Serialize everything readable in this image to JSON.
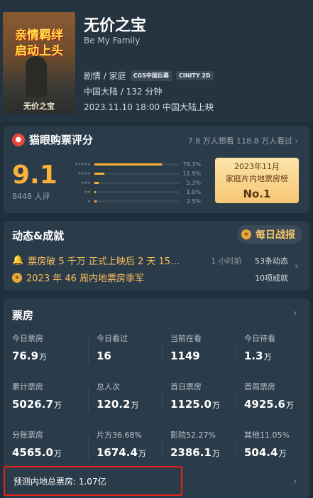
{
  "movie": {
    "poster_slogan_line1": "亲情羁绊",
    "poster_slogan_line2": "启动上头",
    "poster_title": "无价之宝",
    "title": "无价之宝",
    "english_title": "Be My Family",
    "genres": "剧情 / 家庭",
    "badges": [
      "CGS中国巨幕",
      "CINITY 2D"
    ],
    "region_duration": "中国大陆 / 132 分钟",
    "release": "2023.11.10 18:00 中国大陆上映"
  },
  "rating": {
    "header": "猫眼购票评分",
    "icon": "cat-icon",
    "counts": "7.8 万人想看  118.8 万人看过",
    "score": "9.1",
    "score_count": "8448 人评",
    "distribution": [
      {
        "stars": "★★★★★",
        "pct": "79.3%",
        "fraction": 0.793
      },
      {
        "stars": "★★★★",
        "pct": "11.9%",
        "fraction": 0.119
      },
      {
        "stars": "★★★",
        "pct": "5.3%",
        "fraction": 0.053
      },
      {
        "stars": "★★",
        "pct": "1.0%",
        "fraction": 0.01
      },
      {
        "stars": "★",
        "pct": "2.5%",
        "fraction": 0.025
      }
    ],
    "rank_line1": "2023年11月",
    "rank_line2": "家庭片内地票房榜",
    "rank_no": "No.1",
    "accent": "#fcb13a"
  },
  "news": {
    "header": "动态&成就",
    "daily_button": "每日战报",
    "item1": {
      "text": "票房破 5 千万  正式上映后 2 天 15…",
      "time": "1 小时前",
      "count": "53条动态"
    },
    "item2": {
      "text": "2023 年 46 周内地票房季军",
      "count": "10项成就"
    }
  },
  "boxoffice": {
    "header": "票房",
    "rows": [
      [
        {
          "label": "今日票房",
          "value": "76.9",
          "unit": "万"
        },
        {
          "label": "今日看过",
          "value": "16",
          "unit": ""
        },
        {
          "label": "当前在看",
          "value": "1149",
          "unit": ""
        },
        {
          "label": "今日待看",
          "value": "1.3",
          "unit": "万"
        }
      ],
      [
        {
          "label": "累计票房",
          "value": "5026.7",
          "unit": "万"
        },
        {
          "label": "总人次",
          "value": "120.2",
          "unit": "万"
        },
        {
          "label": "首日票房",
          "value": "1125.0",
          "unit": "万"
        },
        {
          "label": "首周票房",
          "value": "4925.6",
          "unit": "万"
        }
      ],
      [
        {
          "label": "分账票房",
          "value": "4565.0",
          "unit": "万"
        },
        {
          "label": "片方36.68%",
          "value": "1674.4",
          "unit": "万"
        },
        {
          "label": "影院52.27%",
          "value": "2386.1",
          "unit": "万"
        },
        {
          "label": "其他11.05%",
          "value": "504.4",
          "unit": "万"
        }
      ]
    ],
    "prediction": "预测内地总票房:  1.07亿",
    "highlight_color": "#e8201a"
  }
}
